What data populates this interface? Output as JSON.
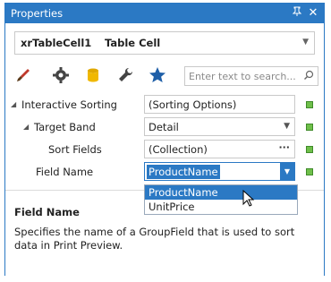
{
  "window": {
    "title": "Properties",
    "pin_icon": "pin-icon",
    "close_icon": "close-icon"
  },
  "selector": {
    "name": "xrTableCell1",
    "type": "Table Cell"
  },
  "toolbar": {
    "tools": [
      "brush-icon",
      "gear-icon",
      "database-icon",
      "wrench-icon",
      "star-icon"
    ],
    "search_placeholder": "Enter text to search..."
  },
  "properties": [
    {
      "label": "Interactive Sorting",
      "value": "(Sorting Options)",
      "expander": "◢"
    },
    {
      "label": "Target Band",
      "value": "Detail",
      "expander": "◢"
    },
    {
      "label": "Sort Fields",
      "value": "(Collection)",
      "button": "···"
    },
    {
      "label": "Field Name",
      "value": "ProductName"
    }
  ],
  "dropdown": {
    "options": [
      "ProductName",
      "UnitPrice"
    ],
    "selected": "ProductName"
  },
  "description": {
    "title": "Field Name",
    "text": "Specifies the name of a GroupField that is used to sort data in Print Preview."
  },
  "colors": {
    "accent": "#2b79c4",
    "status_square": "#6fbf4a"
  }
}
